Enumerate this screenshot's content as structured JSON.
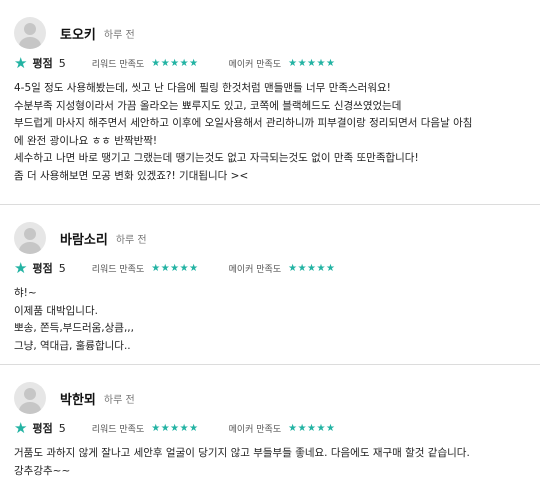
{
  "labels": {
    "score": "평점",
    "delivery": "리워드 만족도",
    "maker": "메이커 만족도",
    "stars": "★★★★★",
    "big_star": "★"
  },
  "reviews": [
    {
      "name": "토오키",
      "time": "하루 전",
      "score": "5",
      "lines": [
        "4-5일 정도 사용해봤는데, 씻고 난 다음에 필링 한것처럼 맨들맨들 너무 만족스러워요!",
        "수분부족 지성형이라서 가끔 올라오는 뾰루지도 있고, 코쪽에 블랙헤드도 신경쓰였었는데",
        "부드럽게 마사지 해주면서 세안하고 이후에 오일사용해서 관리하니까 피부결이랑 정리되면서 다음날 아침",
        "에 완전 광이나요 ㅎㅎ 반짝반짝!",
        "세수하고 나면 바로 땡기고 그랬는데 땡기는것도 없고 자극되는것도 없이 만족 또만족합니다!",
        "좀 더 사용해보면 모공 변화 있겠죠?! 기대됩니다 ><"
      ]
    },
    {
      "name": "바람소리",
      "time": "하루 전",
      "score": "5",
      "lines": [
        "햐!~",
        "이제품 대박입니다.",
        "뽀송, 쫀득,부드러움,상큼,,,",
        "그냥, 역대급, 훌륭합니다.."
      ]
    },
    {
      "name": "박한뫼",
      "time": "하루 전",
      "score": "5",
      "lines": [
        "거품도 과하지 않게 잘나고 세안후 얼굴이 당기지 않고 부들부들 좋네요. 다음에도 재구매 할것 같습니다.",
        "강추강추~~"
      ]
    }
  ]
}
